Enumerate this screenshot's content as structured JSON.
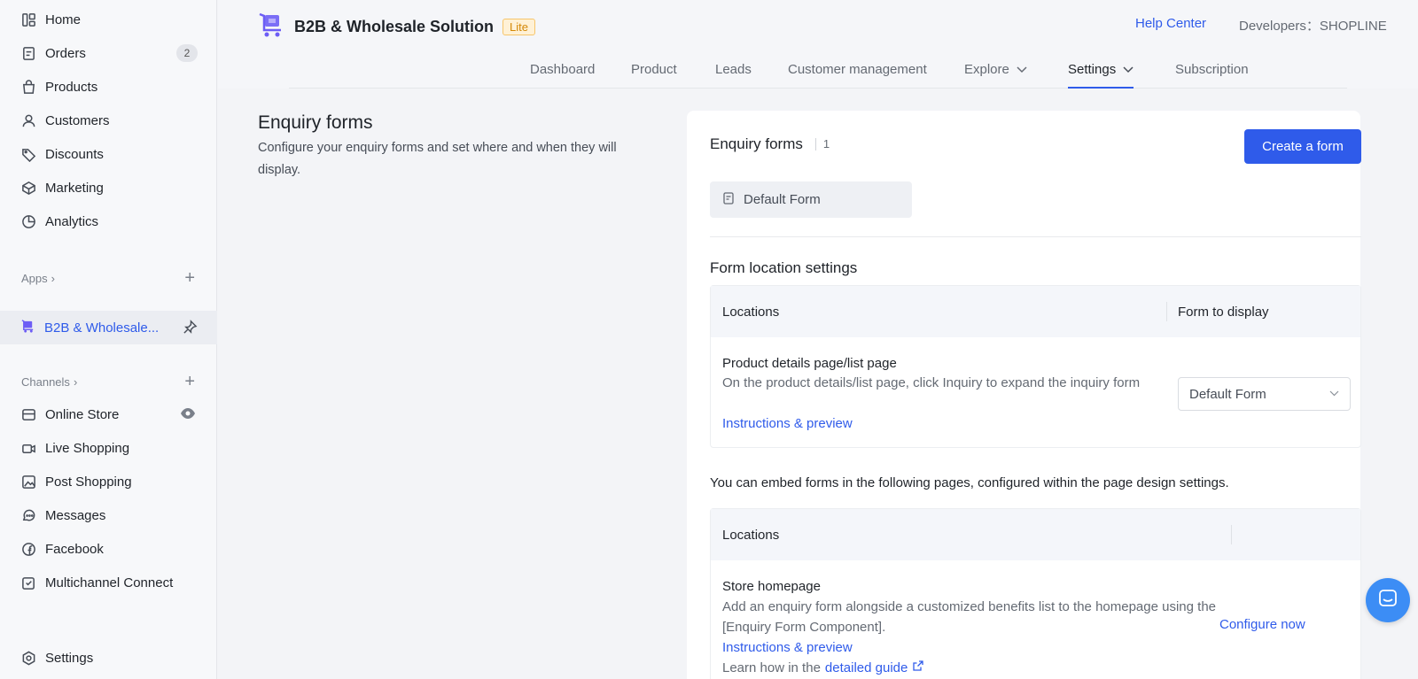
{
  "sidebar": {
    "items": [
      {
        "label": "Home",
        "icon": "home-icon"
      },
      {
        "label": "Orders",
        "icon": "orders-icon",
        "badge": "2"
      },
      {
        "label": "Products",
        "icon": "products-icon"
      },
      {
        "label": "Customers",
        "icon": "customers-icon"
      },
      {
        "label": "Discounts",
        "icon": "tag-icon"
      },
      {
        "label": "Marketing",
        "icon": "marketing-icon"
      },
      {
        "label": "Analytics",
        "icon": "analytics-icon"
      }
    ],
    "apps_label": "Apps",
    "app_item": {
      "label": "B2B & Wholesale...",
      "icon": "b2b-app-icon"
    },
    "channels_label": "Channels",
    "channels": [
      {
        "label": "Online Store",
        "icon": "store-icon"
      },
      {
        "label": "Live Shopping",
        "icon": "video-icon"
      },
      {
        "label": "Post Shopping",
        "icon": "post-icon"
      },
      {
        "label": "Messages",
        "icon": "messages-icon"
      },
      {
        "label": "Facebook",
        "icon": "facebook-icon"
      },
      {
        "label": "Multichannel Connect",
        "icon": "multichannel-icon"
      }
    ],
    "settings_label": "Settings"
  },
  "header": {
    "app_title": "B2B & Wholesale Solution",
    "plan_badge": "Lite",
    "help_center": "Help Center",
    "developers": "Developers：SHOPLINE",
    "tabs": [
      {
        "label": "Dashboard"
      },
      {
        "label": "Product"
      },
      {
        "label": "Leads"
      },
      {
        "label": "Customer management"
      },
      {
        "label": "Explore"
      },
      {
        "label": "Settings"
      },
      {
        "label": "Subscription"
      }
    ]
  },
  "intro": {
    "title": "Enquiry forms",
    "description": "Configure your enquiry forms and set where and when they will display."
  },
  "card": {
    "title": "Enquiry forms",
    "count": "1",
    "create_button": "Create a form",
    "form_chip": "Default Form",
    "location_title": "Form location settings",
    "table1": {
      "col_locations": "Locations",
      "col_form": "Form to display",
      "row_title": "Product details page/list page",
      "row_desc": "On the product details/list page, click Inquiry to expand the inquiry form",
      "row_link": "Instructions & preview",
      "select_value": "Default Form"
    },
    "embed_text": "You can embed forms in the following pages, configured within the page design settings.",
    "table2": {
      "col_locations": "Locations",
      "row_title": "Store homepage",
      "row_desc": "Add an enquiry form alongside a customized benefits list to the homepage using the [Enquiry Form Component].",
      "row_link": "Instructions & preview",
      "learn_prefix": "Learn how in the",
      "learn_link": "detailed guide",
      "configure": "Configure now"
    }
  },
  "colors": {
    "accent": "#2f5bea",
    "badge_bg": "#fff1d6",
    "badge_text": "#d48806"
  }
}
